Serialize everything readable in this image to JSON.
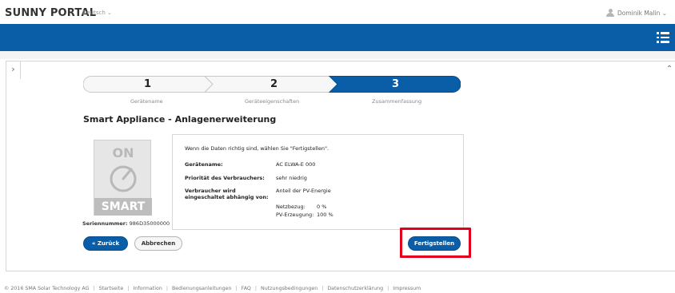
{
  "header": {
    "logo": "SUNNY PORTAL",
    "language": "Deutsch ⌄",
    "user": "Dominik Malin ⌄"
  },
  "nav": {
    "side_toggle": "›",
    "scroll_up": "⌃"
  },
  "steps": [
    {
      "number": "1",
      "caption": "Gerätename"
    },
    {
      "number": "2",
      "caption": "Geräteeigenschaften"
    },
    {
      "number": "3",
      "caption": "Zusammenfassung"
    }
  ],
  "page_title": "Smart Appliance - Anlagenerweiterung",
  "device": {
    "on_label": "ON",
    "smart_label": "SMART",
    "serial_label": "Seriennummer:",
    "serial_value": "986D35000000"
  },
  "summary": {
    "intro": "Wenn die Daten richtig sind, wählen Sie \"Fertigstellen\".",
    "device_name_label": "Gerätename:",
    "device_name_value": "AC ELWA-E 000",
    "priority_label": "Priorität des Verbrauchers:",
    "priority_value": "sehr niedrig",
    "switch_label_1": "Verbraucher wird",
    "switch_label_2": "eingeschaltet abhängig von:",
    "switch_value": "Anteil der PV-Energie",
    "grid_label": "Netzbezug:",
    "grid_value": "0 %",
    "pv_label": "PV-Erzeugung:",
    "pv_value": "100 %"
  },
  "buttons": {
    "back": "« Zurück",
    "cancel": "Abbrechen",
    "finish": "Fertigstellen"
  },
  "footer": {
    "copyright": "© 2016 SMA Solar Technology AG",
    "links": [
      "Startseite",
      "Information",
      "Bedienungsanleitungen",
      "FAQ",
      "Nutzungsbedingungen",
      "Datenschutzerklärung",
      "Impressum"
    ]
  },
  "colors": {
    "brand_blue": "#0a5ea8",
    "highlight_red": "#e3001b"
  }
}
